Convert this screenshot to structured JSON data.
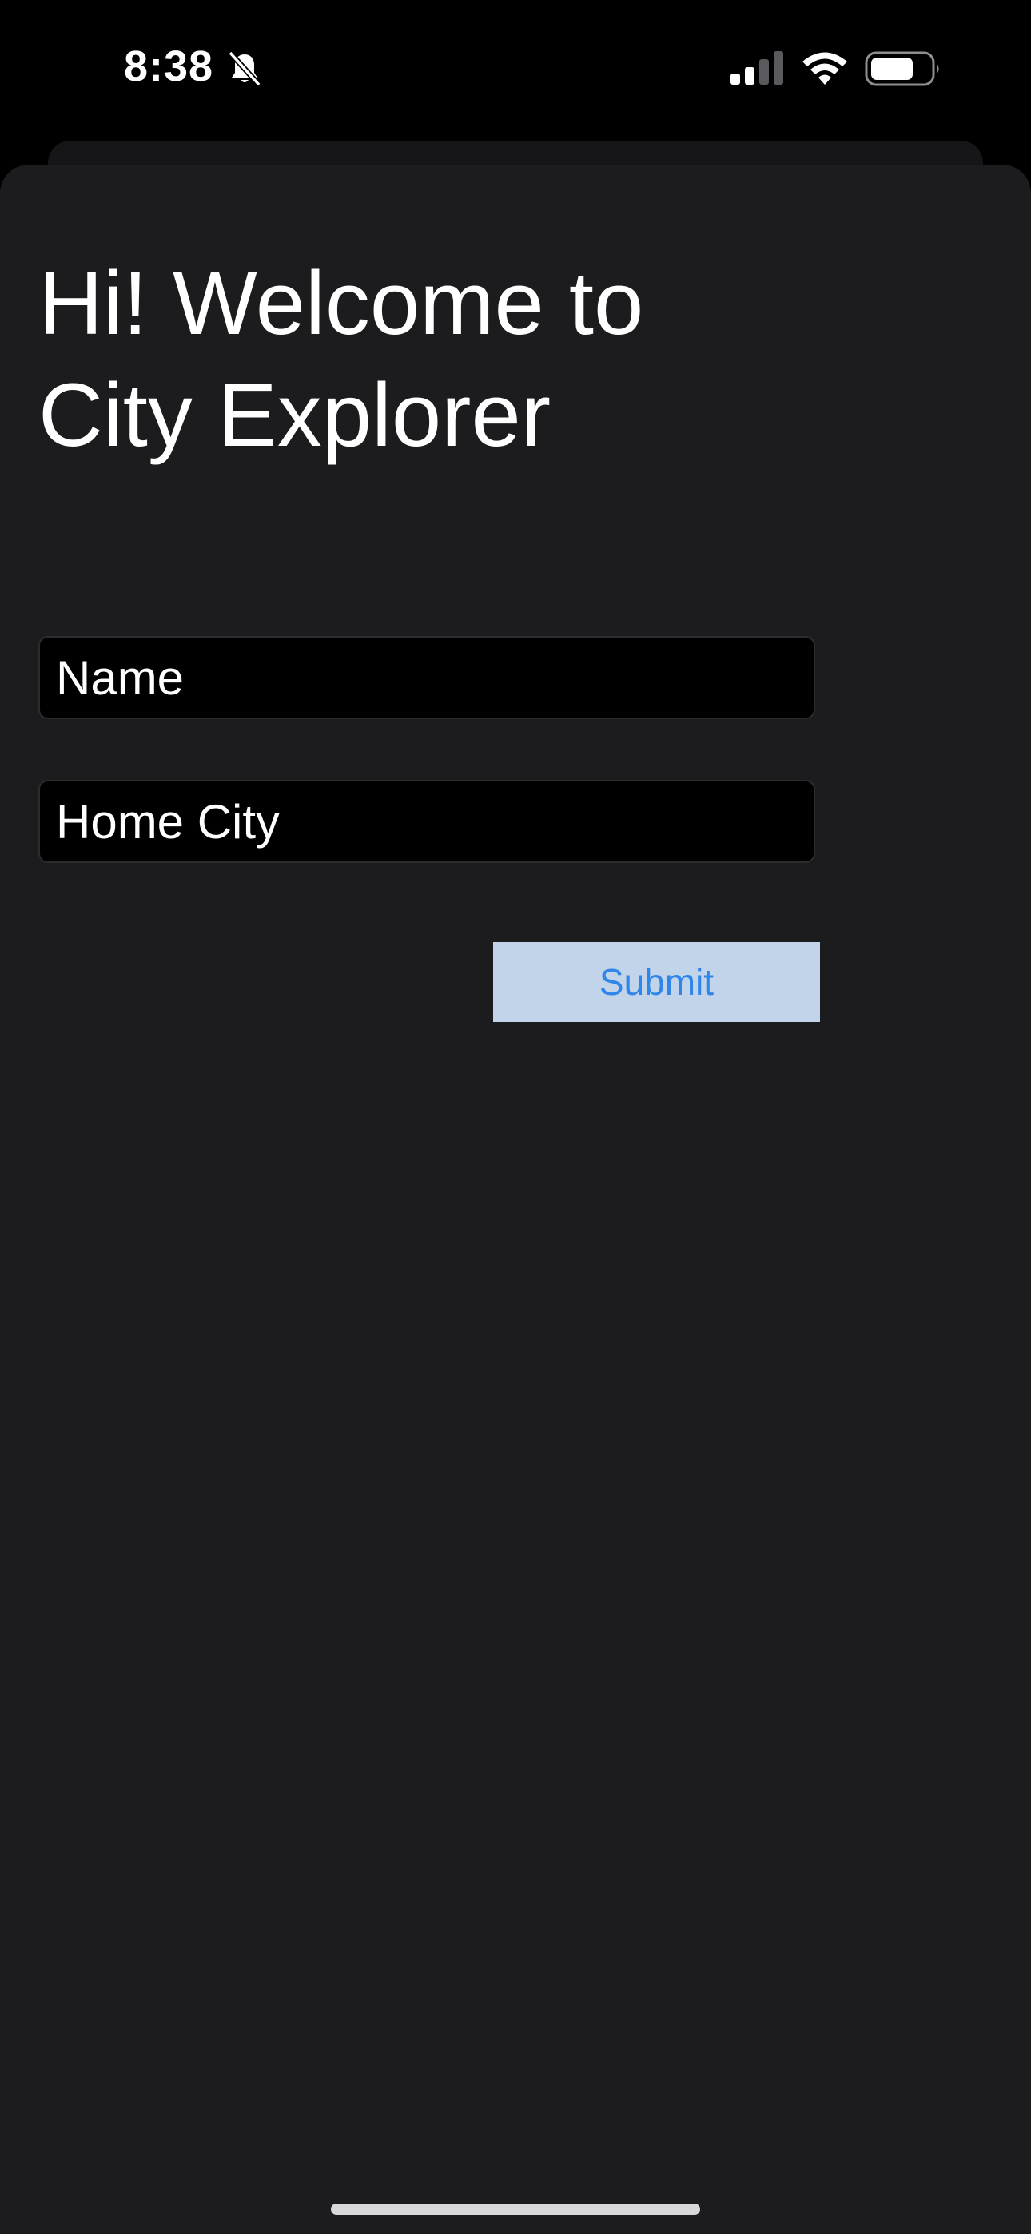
{
  "status_bar": {
    "time": "8:38",
    "icons": [
      "bell-slash-icon",
      "cellular-signal-icon",
      "wifi-icon",
      "battery-icon"
    ]
  },
  "form": {
    "title_line1": "Hi! Welcome to",
    "title_line2": "City Explorer",
    "name_placeholder": "Name",
    "home_city_placeholder": "Home City",
    "submit_label": "Submit"
  },
  "colors": {
    "background": "#1c1c1e",
    "field_background": "#000000",
    "button_background": "#c1d4e9",
    "button_text": "#2f86e8",
    "text": "#ffffff"
  }
}
